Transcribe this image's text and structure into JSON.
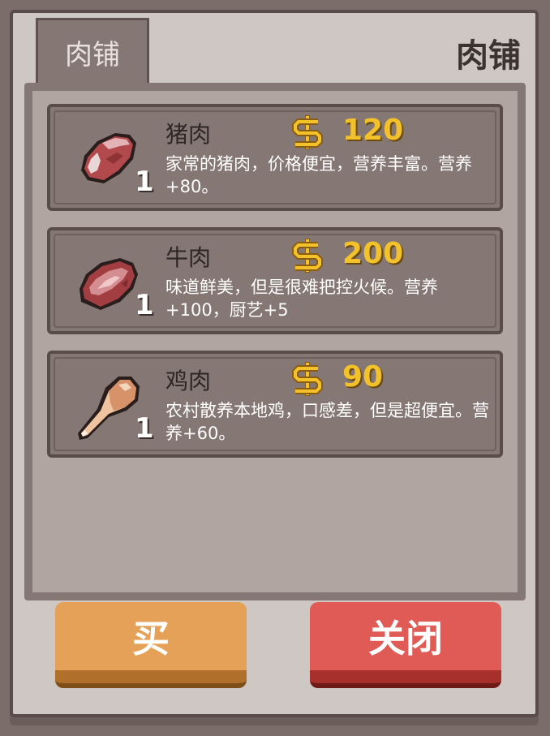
{
  "shop": {
    "tab_label": "肉铺",
    "title": "肉铺"
  },
  "items": [
    {
      "name": "猪肉",
      "price": "120",
      "quantity": "1",
      "icon": "pork-icon",
      "description": "家常的猪肉，价格便宜，营养丰富。营养+80。"
    },
    {
      "name": "牛肉",
      "price": "200",
      "quantity": "1",
      "icon": "beef-icon",
      "description": "味道鲜美，但是很难把控火候。营养+100，厨艺+5"
    },
    {
      "name": "鸡肉",
      "price": "90",
      "quantity": "1",
      "icon": "chicken-leg-icon",
      "description": "农村散养本地鸡，口感差，但是超便宜。营养+60。"
    }
  ],
  "buttons": {
    "buy_label": "买",
    "close_label": "关闭"
  },
  "colors": {
    "price": "#f3c22b",
    "buy_button": "#e6a158",
    "close_button": "#e05b55"
  }
}
